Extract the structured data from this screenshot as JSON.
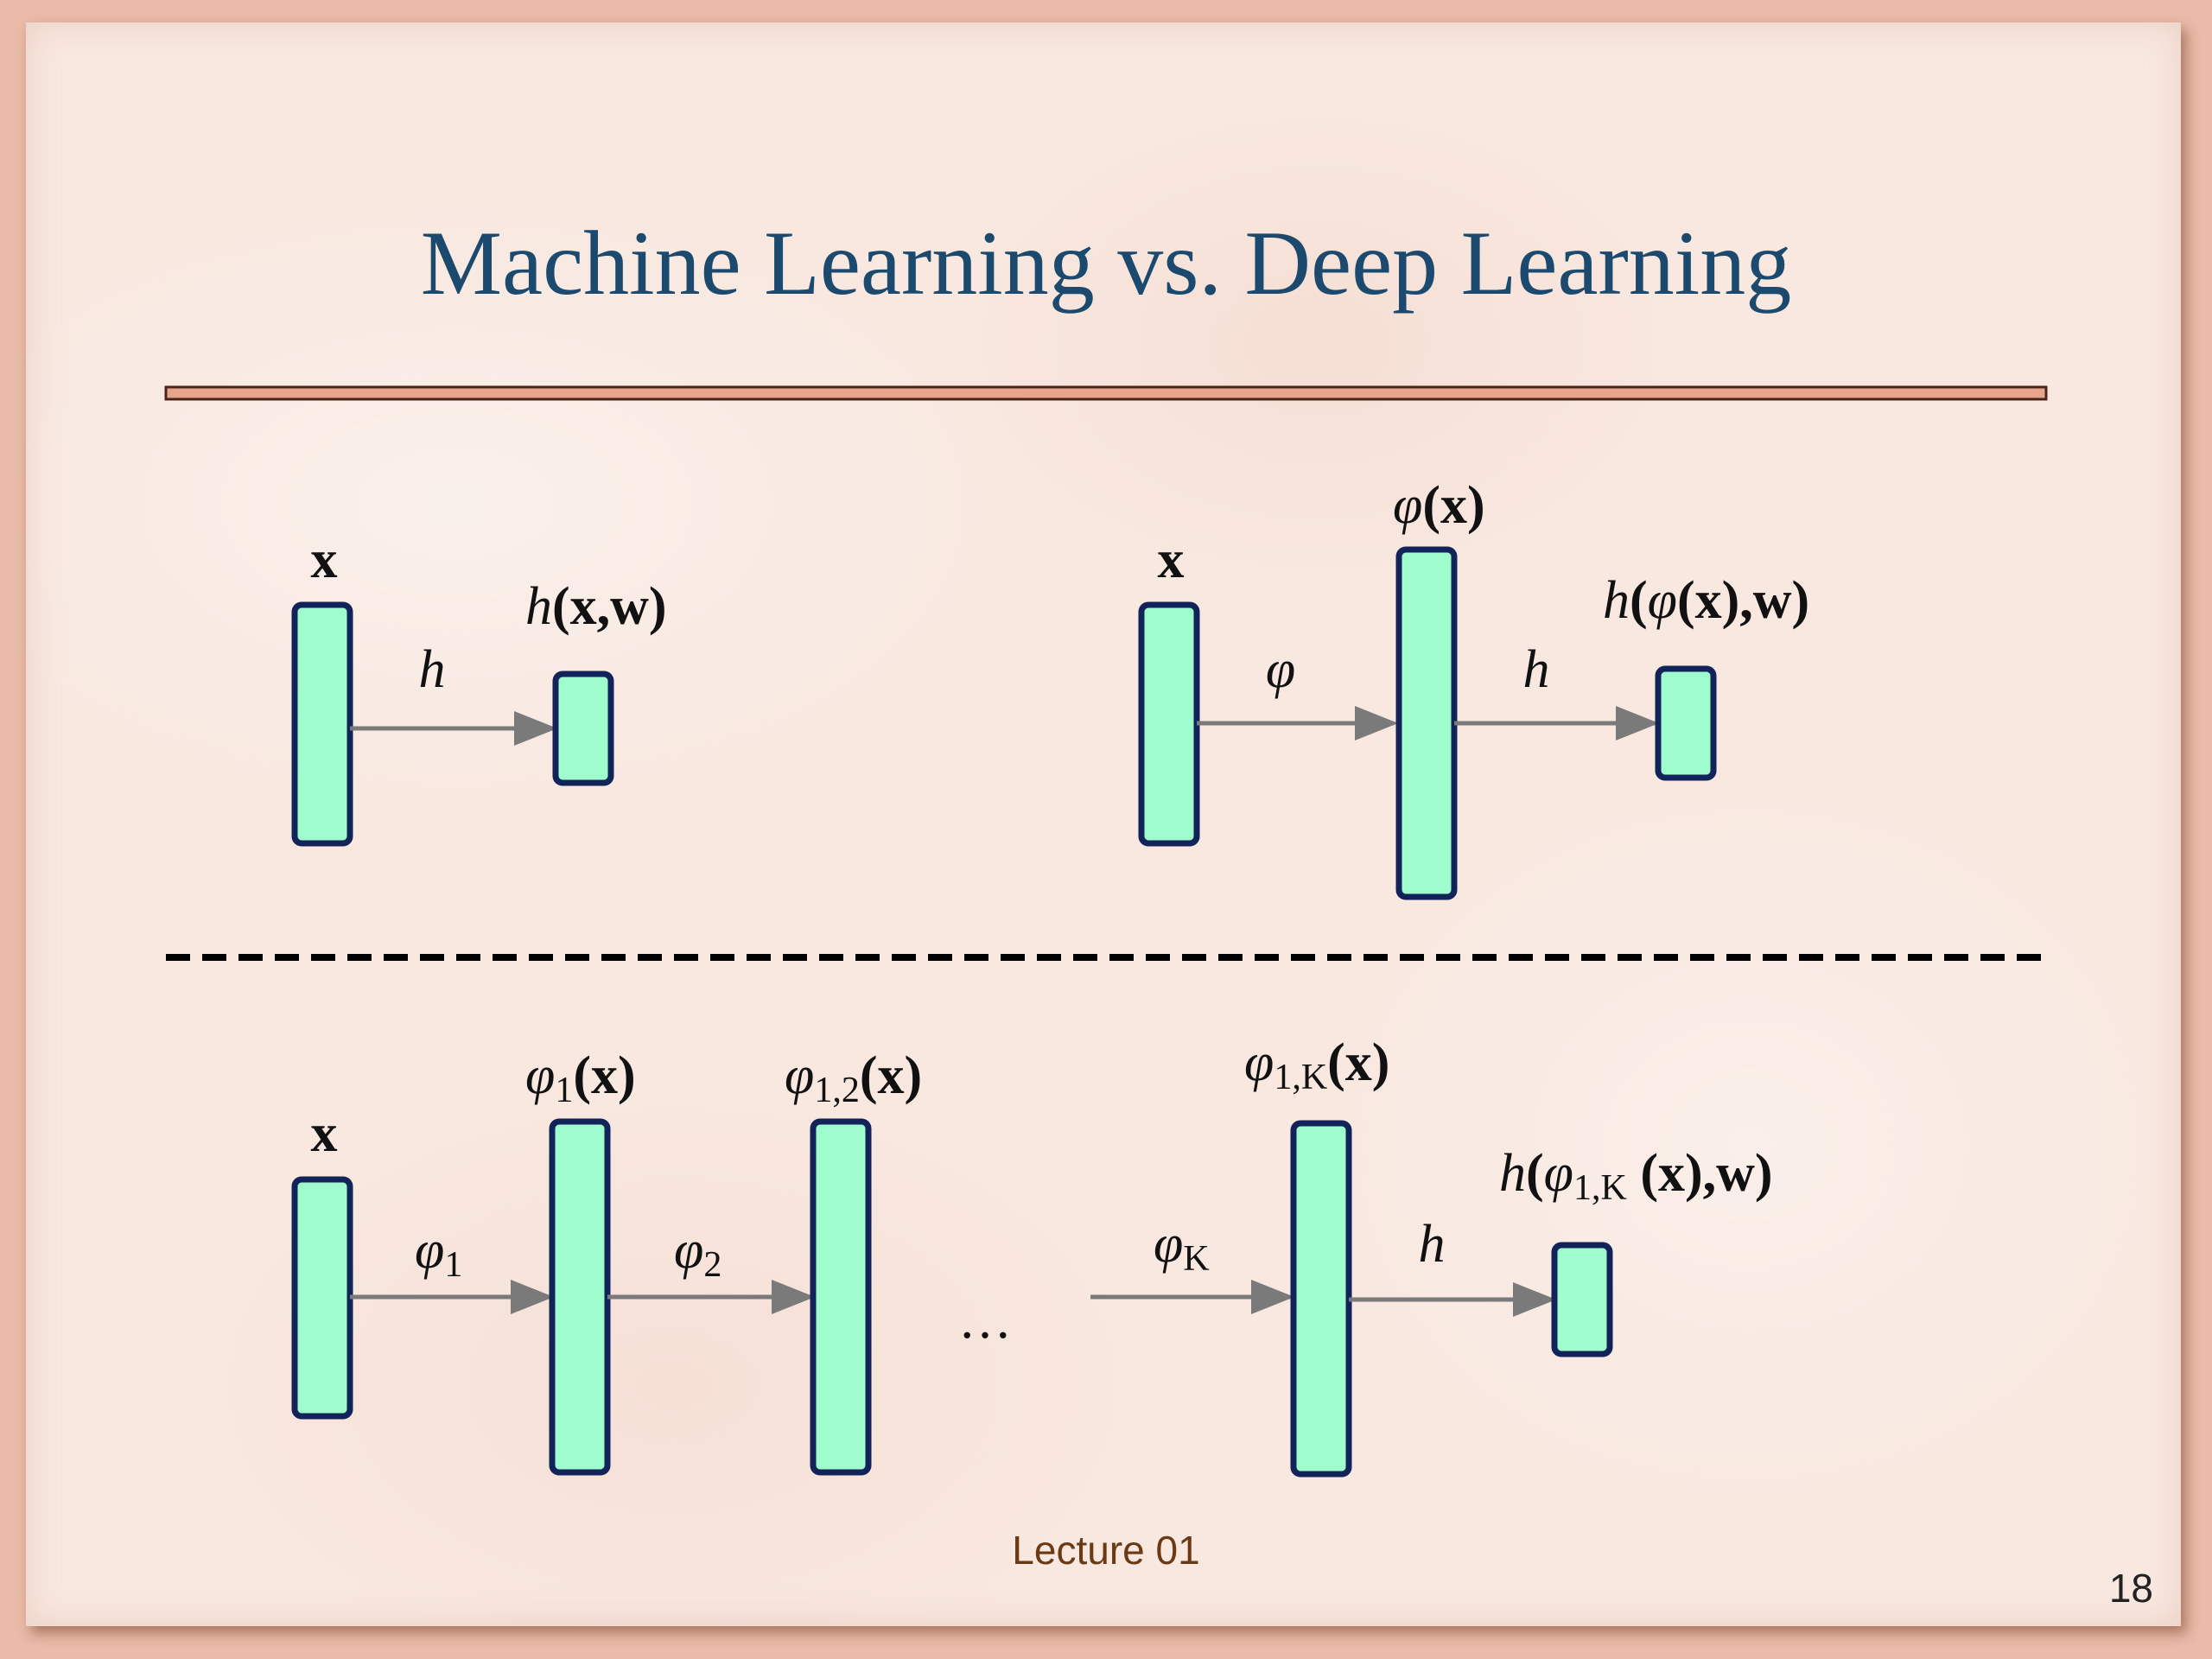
{
  "slide": {
    "title": "Machine Learning vs. Deep Learning",
    "footer": "Lecture 01",
    "page_number": "18"
  },
  "ml": {
    "input": "x",
    "func": "h",
    "output": {
      "h": "h",
      "args": "(x,w)"
    }
  },
  "feature": {
    "input": "x",
    "phi_func": "φ",
    "phi_label": {
      "phi": "φ",
      "args": "(x)"
    },
    "h_func": "h",
    "output": {
      "h": "h",
      "open": "(",
      "phi": "φ",
      "args": "(x),w)"
    }
  },
  "deep": {
    "input": "x",
    "phi1": {
      "phi": "φ",
      "sub": "1"
    },
    "phi1_label": {
      "phi": "φ",
      "sub": "1",
      "args": "(x)"
    },
    "phi2": {
      "phi": "φ",
      "sub": "2"
    },
    "phi12_label": {
      "phi": "φ",
      "sub": "1,2",
      "args": "(x)"
    },
    "ellipsis": "…",
    "phiK": {
      "phi": "φ",
      "sub": "K"
    },
    "phi1K_label": {
      "phi": "φ",
      "sub": "1,K",
      "args": "(x)"
    },
    "h_func": "h",
    "output": {
      "h": "h",
      "open": "(",
      "phi": "φ",
      "sub": "1,K",
      "args": " (x),w)"
    }
  },
  "colors": {
    "box_fill": "#9ffccc",
    "box_stroke": "#12235a",
    "title": "#1c4a6e",
    "arrow": "#7a7a7a"
  }
}
